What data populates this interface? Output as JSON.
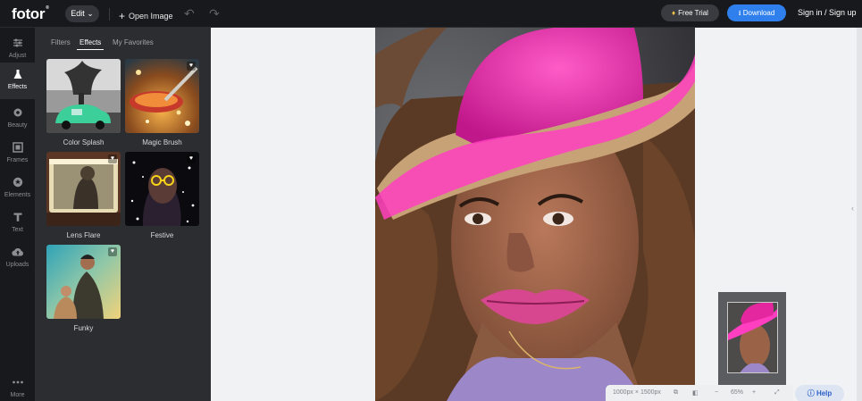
{
  "header": {
    "logo": "fotor",
    "logo_mark": "®",
    "edit_label": "Edit",
    "open_image_label": "Open Image",
    "free_trial_label": "Free Trial",
    "download_label": "Download",
    "signin_label": "Sign in / Sign up"
  },
  "sidebar": {
    "items": [
      {
        "label": "Adjust",
        "icon": "sliders-icon"
      },
      {
        "label": "Effects",
        "icon": "flask-icon"
      },
      {
        "label": "Beauty",
        "icon": "eye-icon"
      },
      {
        "label": "Frames",
        "icon": "frame-icon"
      },
      {
        "label": "Elements",
        "icon": "star-icon"
      },
      {
        "label": "Text",
        "icon": "text-icon"
      },
      {
        "label": "Uploads",
        "icon": "cloud-upload-icon"
      },
      {
        "label": "More",
        "icon": "more-icon"
      }
    ],
    "active": "Effects"
  },
  "panel": {
    "tabs": [
      "Filters",
      "Effects",
      "My Favorites"
    ],
    "active_tab": "Effects",
    "effects": [
      {
        "label": "Color Splash"
      },
      {
        "label": "Magic Brush"
      },
      {
        "label": "Lens Flare"
      },
      {
        "label": "Festive"
      },
      {
        "label": "Funky"
      }
    ]
  },
  "status": {
    "dimensions": "1000px × 1500px",
    "zoom": "65%",
    "help_label": "Help"
  },
  "colors": {
    "accent": "#2f80ed",
    "dark_bg": "#18191c",
    "panel_bg": "#2b2d31",
    "canvas_bg": "#f1f2f4"
  }
}
